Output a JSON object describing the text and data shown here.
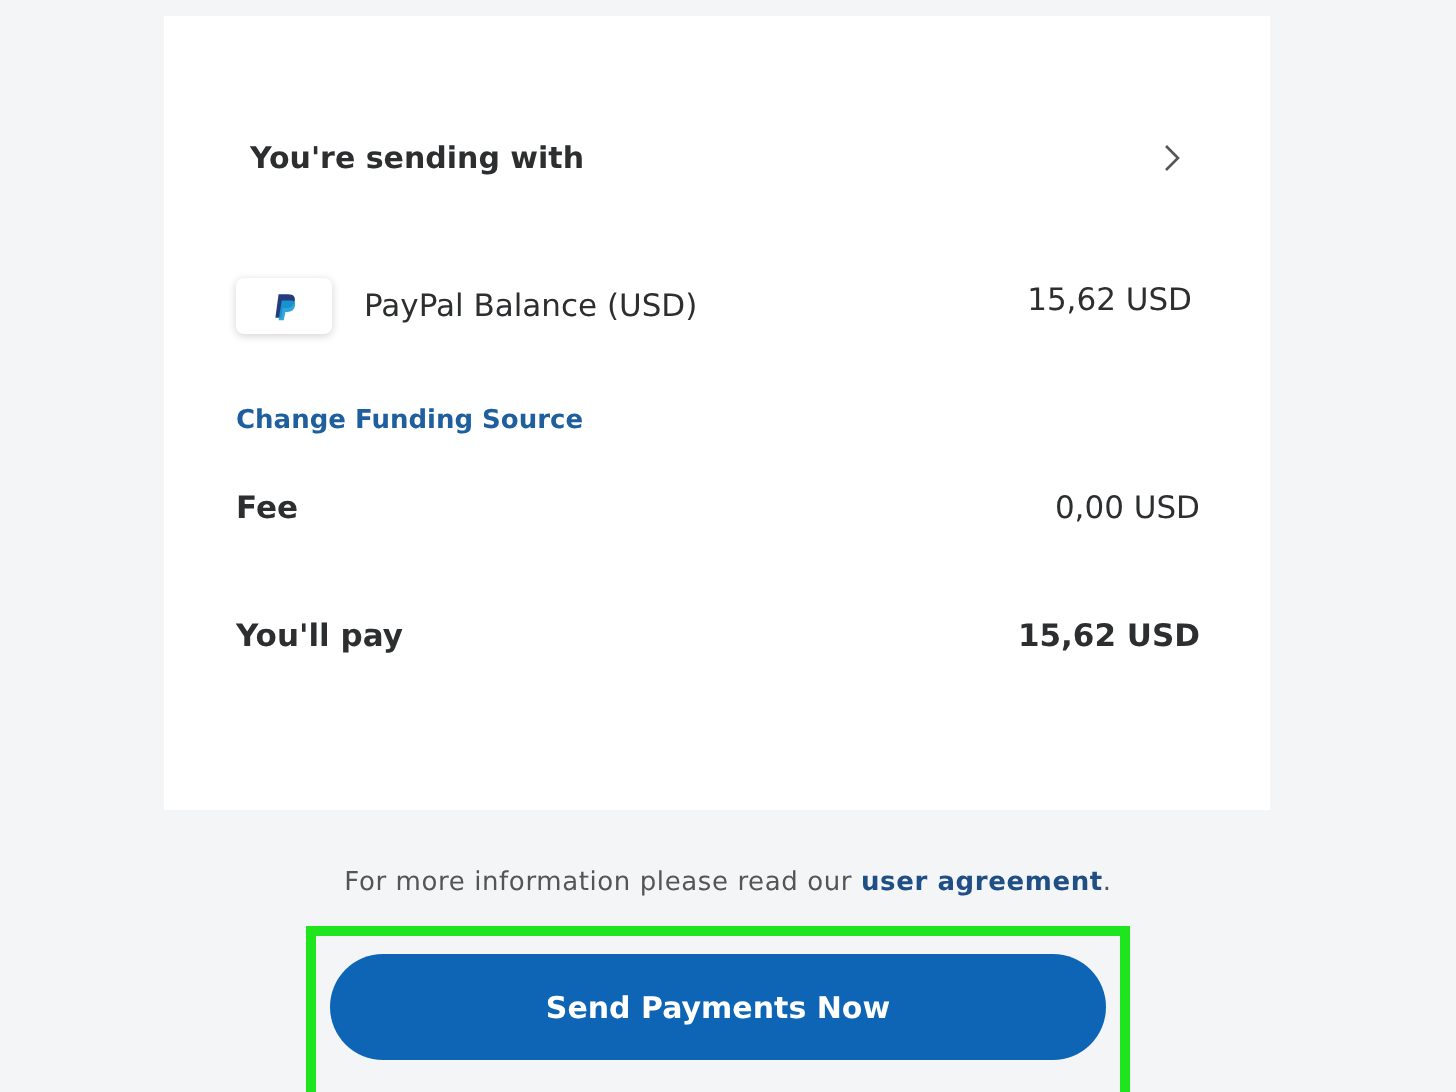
{
  "sending_with": {
    "title": "You're sending with"
  },
  "funding_source": {
    "name": "PayPal Balance (USD)",
    "amount": "15,62 USD"
  },
  "change_link": "Change Funding Source",
  "summary": [
    {
      "label": "Fee",
      "value": "0,00 USD",
      "emphasis": false
    },
    {
      "label": "You'll pay",
      "value": "15,62 USD",
      "emphasis": true
    }
  ],
  "footer_note": {
    "before": "For more information please read our ",
    "link": "user agreement",
    "after": "."
  },
  "send_button": {
    "label": "Send Payments Now",
    "highlighted": true
  }
}
